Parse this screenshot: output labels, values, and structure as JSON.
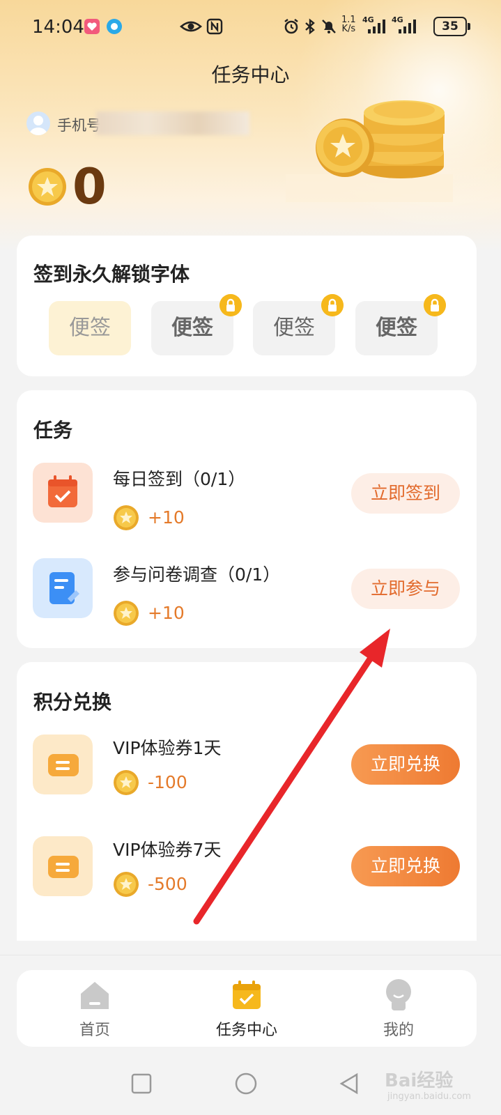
{
  "status_bar": {
    "time": "14:04",
    "speed_top": "1.1",
    "speed_bottom": "K/s",
    "net1": "4G",
    "net2": "4G",
    "battery": "35"
  },
  "header": {
    "title": "任务中心",
    "username_prefix": "手机号",
    "coin_count": "0"
  },
  "fonts_section": {
    "title": "签到永久解锁字体",
    "chips": [
      {
        "label": "便签",
        "locked": false
      },
      {
        "label": "便签",
        "locked": true
      },
      {
        "label": "便签",
        "locked": true
      },
      {
        "label": "便签",
        "locked": true
      }
    ]
  },
  "tasks_section": {
    "title": "任务",
    "items": [
      {
        "title": "每日签到（0/1）",
        "points": "+10",
        "button": "立即签到"
      },
      {
        "title": "参与问卷调查（0/1）",
        "points": "+10",
        "button": "立即参与"
      }
    ]
  },
  "exchange_section": {
    "title": "积分兑换",
    "items": [
      {
        "title": "VIP体验券1天",
        "points": "-100",
        "button": "立即兑换"
      },
      {
        "title": "VIP体验券7天",
        "points": "-500",
        "button": "立即兑换"
      }
    ]
  },
  "bottom_nav": {
    "items": [
      {
        "label": "首页",
        "icon": "home-icon"
      },
      {
        "label": "任务中心",
        "icon": "task-calendar-icon",
        "active": true
      },
      {
        "label": "我的",
        "icon": "profile-icon"
      }
    ]
  },
  "watermark": {
    "text": "Bai经验",
    "sub": "jingyan.baidu.com"
  },
  "colors": {
    "accent": "#ee7a32",
    "coin": "#f5b930",
    "lock": "#f6b81c",
    "arrow": "#e8262a"
  }
}
